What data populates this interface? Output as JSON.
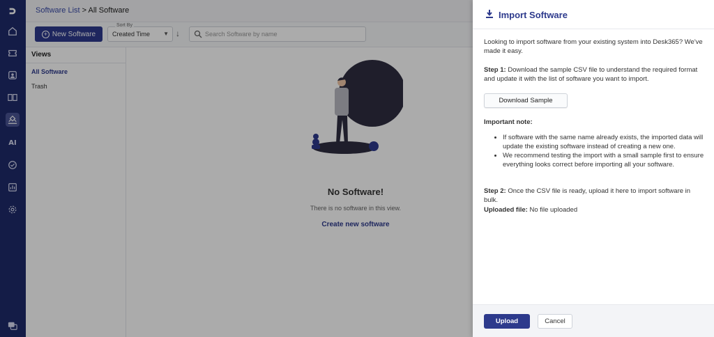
{
  "rail": {
    "ai_label": "AI"
  },
  "breadcrumb": {
    "parent": "Software List",
    "separator": " > ",
    "current": "All Software"
  },
  "toolbar": {
    "new_button": "New Software",
    "sort_label": "Sort By",
    "sort_value": "Created Time",
    "search_placeholder": "Search Software by name"
  },
  "views": {
    "header": "Views",
    "items": [
      {
        "label": "All Software",
        "active": true
      },
      {
        "label": "Trash",
        "active": false
      }
    ]
  },
  "empty_state": {
    "title": "No Software!",
    "subtitle": "There is no software in this view.",
    "cta": "Create new software"
  },
  "drawer": {
    "title": "Import Software",
    "intro": "Looking to import software from your existing system into Desk365? We've made it easy.",
    "step1_label": "Step 1:",
    "step1_text": " Download the sample CSV file to understand the required format and update it with the list of software you want to import.",
    "download_button": "Download Sample",
    "note_header": "Important note:",
    "notes": [
      "If software with the same name already exists, the imported data will update the existing software instead of creating a new one.",
      "We recommend testing the import with a small sample first to ensure everything looks correct before importing all your software."
    ],
    "step2_label": "Step 2:",
    "step2_text": " Once the CSV file is ready, upload it here to import software in bulk.",
    "uploaded_label": "Uploaded file:",
    "uploaded_value": " No file uploaded",
    "upload_button": "Upload",
    "cancel_button": "Cancel"
  },
  "colors": {
    "rail": "#1f2a6b",
    "primary": "#2d3a8c"
  }
}
